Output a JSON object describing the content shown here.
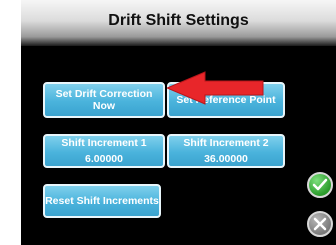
{
  "title": "Drift Shift Settings",
  "buttons": {
    "set_drift": {
      "line1": "Set Drift Correction",
      "line2": "Now"
    },
    "reference_point": {
      "label": "Set Reference Point"
    },
    "shift_increment_1": {
      "label": "Shift Increment 1",
      "value": "6.00000"
    },
    "shift_increment_2": {
      "label": "Shift Increment 2",
      "value": "36.00000"
    },
    "reset": {
      "label": "Reset Shift Increments"
    }
  },
  "icons": {
    "accept": "check-icon",
    "cancel": "close-icon",
    "arrow": "pointer-arrow-icon"
  },
  "colors": {
    "button": "#4ab3dc",
    "accept": "#2a9a2a",
    "cancel": "#7a7a7a",
    "arrow": "#e8262a"
  }
}
